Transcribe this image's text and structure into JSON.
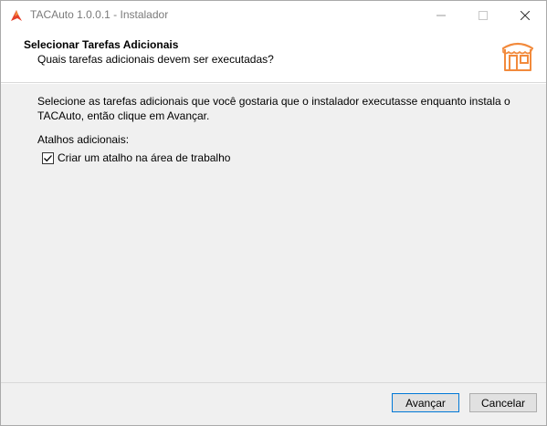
{
  "window": {
    "title": "TACAuto 1.0.0.1 - Instalador",
    "controls": {
      "minimize": "—",
      "maximize": "☐",
      "close": "✕"
    }
  },
  "header": {
    "title": "Selecionar Tarefas Adicionais",
    "subtitle": "Quais tarefas adicionais devem ser executadas?",
    "logo_icon": "store-icon"
  },
  "body": {
    "description": "Selecione as tarefas adicionais que você gostaria que o instalador executasse enquanto instala o TACAuto, então clique em Avançar.",
    "group_label": "Atalhos adicionais:",
    "tasks": [
      {
        "label": "Criar um atalho na área de trabalho",
        "checked": true
      }
    ]
  },
  "footer": {
    "next_label": "Avançar",
    "cancel_label": "Cancelar"
  },
  "colors": {
    "accent": "#0078d7",
    "logo_orange": "#f28a3c",
    "app_icon_red": "#e5412b"
  }
}
